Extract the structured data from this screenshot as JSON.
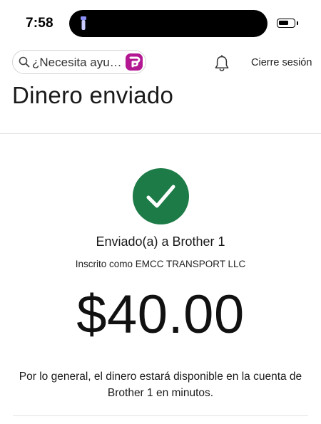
{
  "status_bar": {
    "time": "7:58",
    "battery_level": 0.7
  },
  "header": {
    "search_placeholder": "¿Necesita ayu…",
    "search_icon": "search-icon",
    "assistant_icon": "fargo-assistant-icon",
    "notifications_icon": "bell-icon",
    "signout_label": "Cierre sesión"
  },
  "page": {
    "title": "Dinero enviado"
  },
  "confirmation": {
    "status_icon": "checkmark-icon",
    "status_color": "#1c7b46",
    "sent_to": "Enviado(a) a Brother 1",
    "enrolled_as": "Inscrito como EMCC TRANSPORT LLC",
    "amount": "$40.00",
    "availability_note": "Por lo general, el dinero estará disponible en la cuenta de Brother 1 en minutos."
  }
}
